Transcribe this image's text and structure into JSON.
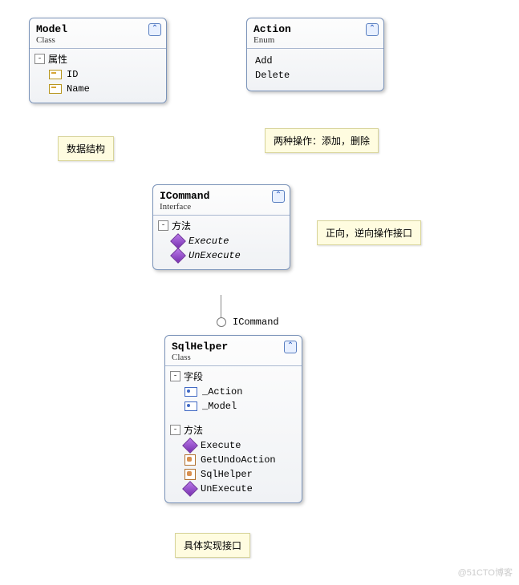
{
  "boxes": {
    "model": {
      "title": "Model",
      "type": "Class",
      "sections": [
        {
          "label": "属性",
          "kind": "prop",
          "items": [
            "ID",
            "Name"
          ]
        }
      ]
    },
    "action": {
      "title": "Action",
      "type": "Enum",
      "items": [
        "Add",
        "Delete"
      ]
    },
    "icommand": {
      "title": "ICommand",
      "type": "Interface",
      "sections": [
        {
          "label": "方法",
          "kind": "method",
          "italic": true,
          "items": [
            "Execute",
            "UnExecute"
          ]
        }
      ]
    },
    "sqlhelper": {
      "title": "SqlHelper",
      "type": "Class",
      "sections": [
        {
          "label": "字段",
          "kind": "field",
          "items": [
            "_Action",
            "_Model"
          ]
        },
        {
          "label": "方法",
          "kind": "method",
          "items": [
            "Execute",
            "GetUndoAction",
            "SqlHelper",
            "UnExecute"
          ]
        }
      ]
    }
  },
  "notes": {
    "model": "数据结构",
    "action": "两种操作：添加，删除",
    "icommand": "正向，逆向操作接口",
    "sqlhelper": "具体实现接口"
  },
  "connector_label": "ICommand",
  "watermark": "@51CTO博客"
}
